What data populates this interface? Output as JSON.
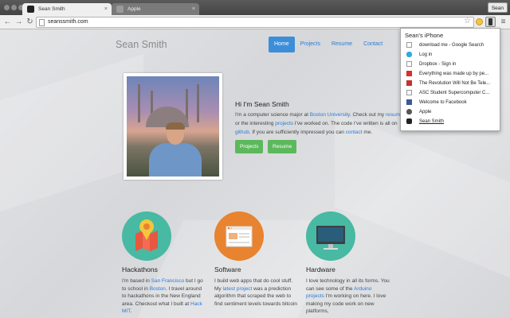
{
  "browser": {
    "tabs": [
      {
        "label": "Sean Smith",
        "active": true
      },
      {
        "label": "Apple",
        "active": false
      }
    ],
    "profile_label": "Sean",
    "url": "seanssmith.com",
    "star_glyph": "☆",
    "menu_glyph": "≡"
  },
  "site": {
    "brand": "Sean Smith",
    "nav": [
      "Home",
      "Projects",
      "Resume",
      "Contact"
    ],
    "greeting": "Hi I'm Sean Smith",
    "bio": {
      "t1": "I'm a computer science major at ",
      "l1": "Boston University",
      "t2": ". Check out my ",
      "l2": "resume",
      "t3": ", or the interesting ",
      "l3": "projects",
      "t4": " I've worked on. The code I've written is all on ",
      "l4": "github",
      "t5": ". If you are sufficiently impressed you can ",
      "l5": "contact",
      "t6": " me."
    },
    "buttons": [
      "Projects",
      "Resume"
    ],
    "features": [
      {
        "title": "Hackathons",
        "color": "#48b9a3",
        "t1": "I'm based in ",
        "l1": "San Francisco",
        "t2": " but I go to school in ",
        "l2": "Boston",
        "t3": ". I travel around to hackathons in the New England area. Checkout what I built at ",
        "l3": "Hack MIT",
        "t4": "."
      },
      {
        "title": "Software",
        "color": "#e8832f",
        "t1": "I build web apps that do cool stuff. My ",
        "l1": "latest project",
        "t2": " was a prediction algorithm that scraped the web to find sentiment levels towards bitcoin"
      },
      {
        "title": "Hardware",
        "color": "#48b9a3",
        "t1": "I love technology in all its forms. You can see some of the ",
        "l1": "Arduino projects",
        "t2": " I'm working on here. I love making my code work on new platforms,"
      }
    ]
  },
  "popup": {
    "title": "Sean's iPhone",
    "items": [
      {
        "label": "download me - Google Search",
        "icon": "page-icon",
        "color": "#ffffff"
      },
      {
        "label": "Log in",
        "icon": "twitter-icon",
        "color": "#2fa9e0"
      },
      {
        "label": "Dropbox - Sign in",
        "icon": "page-icon",
        "color": "#ffffff"
      },
      {
        "label": "Everything was made up by pe...",
        "icon": "red-favicon-icon",
        "color": "#d9302c"
      },
      {
        "label": "The Revolution Will Not Be Tele...",
        "icon": "red-favicon-icon",
        "color": "#c4332c"
      },
      {
        "label": "ASC Student Supercomputer C...",
        "icon": "page-icon",
        "color": "#ffffff"
      },
      {
        "label": "Welcome to Facebook",
        "icon": "facebook-icon",
        "color": "#3b5998"
      },
      {
        "label": "Apple",
        "icon": "apple-icon",
        "color": "#555555"
      },
      {
        "label": "Sean Smith",
        "icon": "site-favicon-icon",
        "color": "#222222"
      }
    ]
  }
}
